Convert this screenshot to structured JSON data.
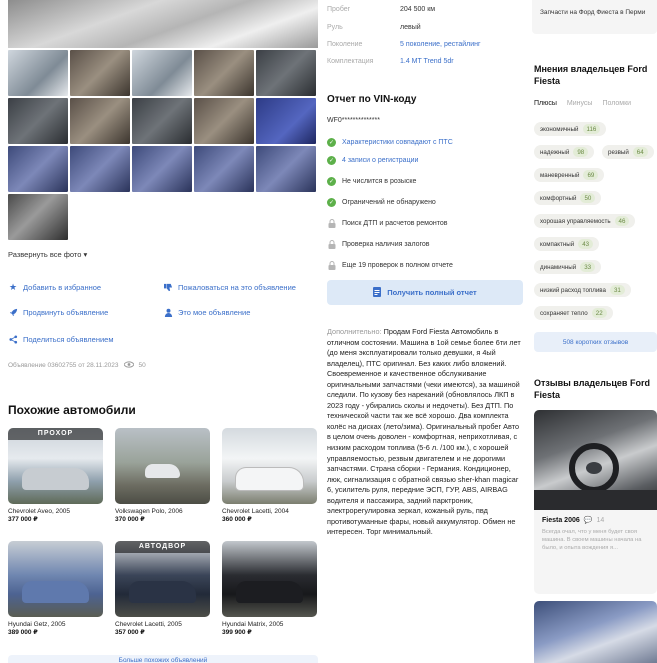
{
  "gallery": {
    "expand_label": "Развернуть все фото"
  },
  "actions": {
    "favorite": "Добавить в избранное",
    "complain": "Пожаловаться на это объявление",
    "promote": "Продвинуть объявление",
    "mine": "Это мое объявление",
    "share": "Поделиться объявлением"
  },
  "meta": {
    "listing_info": "Объявление 03602755 от 28.11.2023",
    "views": "50"
  },
  "similar": {
    "title": "Похожие автомобили",
    "cars": [
      {
        "name": "Chevrolet Aveo, 2005",
        "price": "377 000 ₽",
        "banner": "ПРОХОР"
      },
      {
        "name": "Volkswagen Polo, 2006",
        "price": "370 000 ₽",
        "banner": ""
      },
      {
        "name": "Chevrolet Lacetti, 2004",
        "price": "360 000 ₽",
        "banner": ""
      },
      {
        "name": "Hyundai Getz, 2005",
        "price": "389 000 ₽",
        "banner": ""
      },
      {
        "name": "Chevrolet Lacetti, 2005",
        "price": "357 000 ₽",
        "banner": "АВТОДВОР"
      },
      {
        "name": "Hyundai Matrix, 2005",
        "price": "399 900 ₽",
        "banner": ""
      }
    ],
    "more_label": "Больше похожих объявлений"
  },
  "specs": [
    {
      "key": "Пробег",
      "value": "204 500 км",
      "link": false
    },
    {
      "key": "Руль",
      "value": "левый",
      "link": false
    },
    {
      "key": "Поколение",
      "value": "5 поколение, рестайлинг",
      "link": true
    },
    {
      "key": "Комплектация",
      "value": "1.4 MT Trend 5dr",
      "link": true
    }
  ],
  "vin": {
    "title": "Отчет по VIN-коду",
    "code": "WF0**************",
    "checks": [
      {
        "text": "Характеристики совпадают с ПТС",
        "status": "ok",
        "link": true
      },
      {
        "text": "4 записи о регистрации",
        "status": "ok",
        "link": true
      },
      {
        "text": "Не числится в розыске",
        "status": "ok",
        "link": false
      },
      {
        "text": "Ограничений не обнаружено",
        "status": "ok",
        "link": false
      },
      {
        "text": "Поиск ДТП и расчетов ремонтов",
        "status": "locked",
        "link": false
      },
      {
        "text": "Проверка наличия залогов",
        "status": "locked",
        "link": false
      },
      {
        "text": "Еще 19 проверок в полном отчете",
        "status": "locked",
        "link": false
      }
    ],
    "button": "Получить полный отчет"
  },
  "description": {
    "label": "Дополнительно:",
    "text": "Продам Ford Fiesta Автомобиль в отличном состоянии. Машина в 1ой семье более 6ти лет (до меня эксплуатировали только девушки, я 4ый владелец), ПТС оригинал. Без каких либо вложений. Своевременное и качественное обслуживание оригинальными запчастями (чеки имеются), за машиной следили. По кузову без нареканий (обновлялось ЛКП в 2023 году - убирались сколы и недочеты). Без ДТП. По технической части так же всё хорошо. Два комплекта колёс на дисках (лето/зима). Оригинальный пробег Авто в целом очень доволен - комфортная, неприхотливая, с низким расходом топлива (5-6 л. /100 км.), с хорошей управляемостью, резвым двигателем и не дорогими запчастями. Страна сборки - Германия. Кондиционер, люк, сигнализация с обратной связью sher-khan magicar 6, усилитель руля, передние ЭСП, ГУР, ABS, AIRBAG водителя и пассажира, задний парктроник, электрорегулировка зеркал, кожаный руль, пвд противотуманные фары, новый аккумулятор. Обмен не интересен. Торг минимальный."
  },
  "sidebar": {
    "parts_text": "Запчасти на Форд Фиеста в Перми",
    "opinions_title": "Мнения владельцев Ford Fiesta",
    "tabs": [
      "Плюсы",
      "Минусы",
      "Поломки"
    ],
    "tags": [
      {
        "label": "экономичный",
        "count": "116"
      },
      {
        "label": "надежный",
        "count": "98"
      },
      {
        "label": "резвый",
        "count": "64"
      },
      {
        "label": "маневренный",
        "count": "69"
      },
      {
        "label": "комфортный",
        "count": "50"
      },
      {
        "label": "хорошая управляемость",
        "count": "46"
      },
      {
        "label": "компактный",
        "count": "43"
      },
      {
        "label": "динамичный",
        "count": "33"
      },
      {
        "label": "низкий расход топлива",
        "count": "31"
      },
      {
        "label": "сохраняет тепло",
        "count": "22"
      }
    ],
    "reviews_button": "508 коротких отзывов",
    "reviews_title": "Отзывы владельцев Ford Fiesta",
    "review": {
      "name": "Fiesta 2006",
      "comments": "14",
      "text": "Всегда очал, что у меня будет своя машина. В своем машины начала на было, и опыта вождения я..."
    }
  }
}
